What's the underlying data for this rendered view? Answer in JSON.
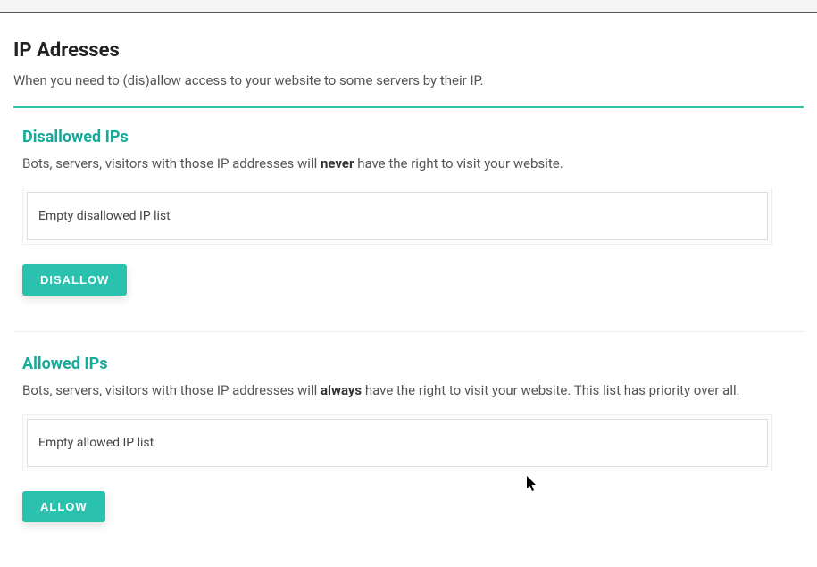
{
  "page": {
    "title": "IP Adresses",
    "subtitle": "When you need to (dis)allow access to your website to some servers by their IP."
  },
  "disallowed": {
    "title": "Disallowed IPs",
    "desc_pre": "Bots, servers, visitors with those IP addresses will ",
    "desc_strong": "never",
    "desc_post": " have the right to visit your website.",
    "list_empty": "Empty disallowed IP list",
    "button": "DISALLOW"
  },
  "allowed": {
    "title": "Allowed IPs",
    "desc_pre": "Bots, servers, visitors with those IP addresses will ",
    "desc_strong": "always",
    "desc_post": " have the right to visit your website. This list has priority over all.",
    "list_empty": "Empty allowed IP list",
    "button": "ALLOW"
  }
}
